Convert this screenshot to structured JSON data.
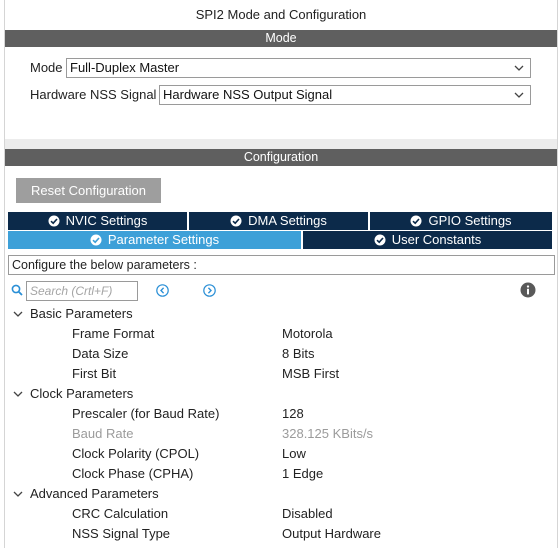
{
  "window": {
    "title": "SPI2 Mode and Configuration"
  },
  "mode_section": {
    "header": "Mode",
    "mode_label": "Mode",
    "mode_value": "Full-Duplex Master",
    "nss_label": "Hardware NSS Signal",
    "nss_value": "Hardware NSS Output Signal"
  },
  "config_section": {
    "header": "Configuration",
    "reset_button": "Reset Configuration",
    "tabs_row1": [
      {
        "label": "NVIC Settings",
        "active": false
      },
      {
        "label": "DMA Settings",
        "active": false
      },
      {
        "label": "GPIO Settings",
        "active": false
      }
    ],
    "tabs_row2": [
      {
        "label": "Parameter Settings",
        "active": true
      },
      {
        "label": "User Constants",
        "active": false
      }
    ],
    "configure_text": "Configure the below parameters :",
    "search_placeholder": "Search (Crtl+F)"
  },
  "parameters": {
    "basic": {
      "label": "Basic Parameters",
      "items": [
        {
          "name": "Frame Format",
          "value": "Motorola",
          "enabled": true
        },
        {
          "name": "Data Size",
          "value": "8 Bits",
          "enabled": true
        },
        {
          "name": "First Bit",
          "value": "MSB First",
          "enabled": true
        }
      ]
    },
    "clock": {
      "label": "Clock Parameters",
      "items": [
        {
          "name": "Prescaler (for Baud Rate)",
          "value": "128",
          "enabled": true
        },
        {
          "name": "Baud Rate",
          "value": "328.125 KBits/s",
          "enabled": false
        },
        {
          "name": "Clock Polarity (CPOL)",
          "value": "Low",
          "enabled": true
        },
        {
          "name": "Clock Phase (CPHA)",
          "value": "1 Edge",
          "enabled": true
        }
      ]
    },
    "advanced": {
      "label": "Advanced Parameters",
      "items": [
        {
          "name": "CRC Calculation",
          "value": "Disabled",
          "enabled": true
        },
        {
          "name": "NSS Signal Type",
          "value": "Output Hardware",
          "enabled": true
        }
      ]
    }
  },
  "colors": {
    "section_header": "#5f5f5f",
    "tab_inactive": "#0c2a4a",
    "tab_active": "#3da0d8",
    "reset_button": "#9e9e9e",
    "disabled_text": "#9b9b9b",
    "accent_icon": "#2a8fd6"
  }
}
